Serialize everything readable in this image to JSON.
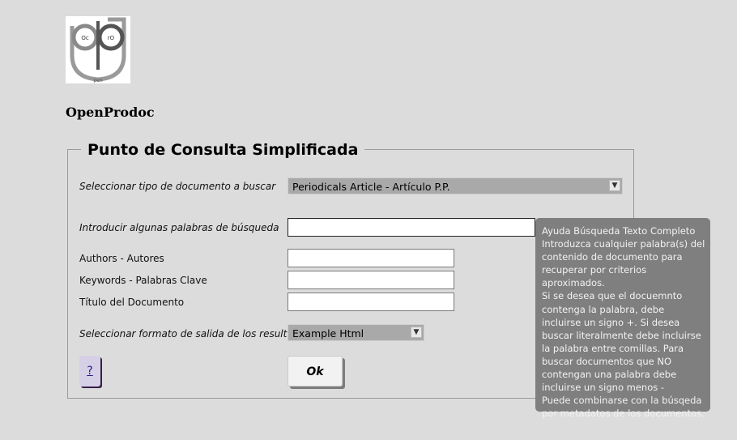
{
  "app": {
    "name": "OpenProdoc"
  },
  "logo": {
    "text_left": "Oc",
    "text_right": "rO",
    "text_bottom": "pen"
  },
  "panel": {
    "title": "Punto de Consulta Simplificada"
  },
  "form": {
    "doc_type_label": "Seleccionar tipo de documento a buscar",
    "doc_type_value": "Periodicals Article - Artículo P.P.",
    "keywords_label": "Introducir algunas palabras de búsqueda",
    "keywords_value": "",
    "authors_label": "Authors - Autores",
    "authors_value": "",
    "kw_label": "Keywords - Palabras Clave",
    "kw_value": "",
    "title_label": "Título del Documento",
    "title_value": "",
    "output_label": "Seleccionar formato de salida de los resultados",
    "output_value": "Example Html",
    "help_label": "?",
    "ok_label": "Ok"
  },
  "tooltip": {
    "text": "Ayuda Búsqueda Texto Completo\nIntroduzca cualquier palabra(s) del contenido de documento para recuperar por criterios aproximados.\nSi se desea que el docuemnto contenga la palabra, debe incluirse un signo +. Si desea buscar literalmente debe incluirse la palabra entre comillas. Para buscar documentos que NO contengan una palabra debe incluirse un signo menos -\nPuede combinarse con la búsqeda por metadatos de los documentos."
  },
  "icons": {
    "dropdown": "chevron-down-icon"
  }
}
